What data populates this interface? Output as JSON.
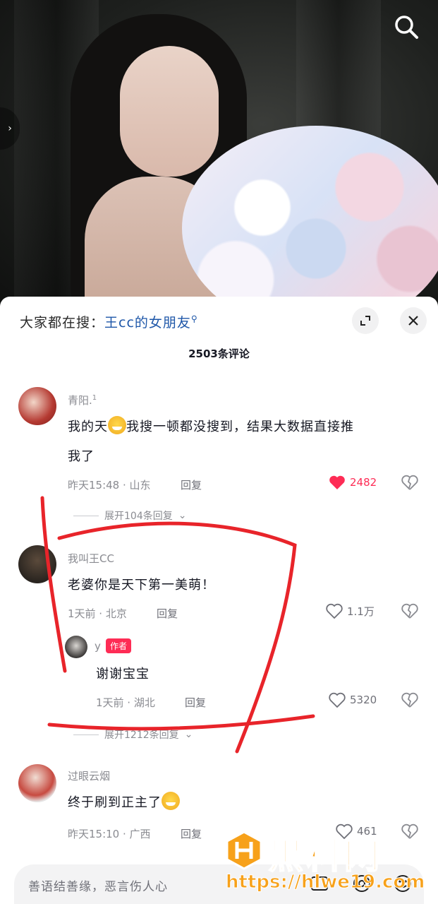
{
  "sheet": {
    "search_prefix": "大家都在搜：",
    "search_keyword": "王cc的女朋友",
    "comment_count": "2503条评论"
  },
  "comments": [
    {
      "username": "青阳.",
      "username_sup": "1",
      "text_before_emoji": "我的天",
      "text_after_emoji": "我搜一顿都没搜到，结果大数据直接推",
      "text_line2": "我了",
      "meta": "昨天15:48 · 山东",
      "reply_label": "回复",
      "likes": "2482",
      "liked": true,
      "expand": "展开104条回复"
    },
    {
      "username": "我叫王CC",
      "text": "老婆你是天下第一美萌！",
      "meta": "1天前 · 北京",
      "reply_label": "回复",
      "likes": "1.1万",
      "expand": "展开1212条回复",
      "reply": {
        "username": "y",
        "badge": "作者",
        "text": "谢谢宝宝",
        "meta": "1天前 · 湖北",
        "reply_label": "回复",
        "likes": "5320"
      }
    },
    {
      "username": "过眼云烟",
      "text": "终于刷到正主了",
      "meta": "昨天15:10 · 广西",
      "reply_label": "回复",
      "likes": "461"
    }
  ],
  "input": {
    "placeholder": "善语结善缘，恶言伤人心"
  },
  "watermark": {
    "title": "黑料网",
    "url": "https://hlwe19.com"
  },
  "colors": {
    "accent": "#fe2c55",
    "link": "#1d56a8",
    "annotation": "#e8242a"
  }
}
